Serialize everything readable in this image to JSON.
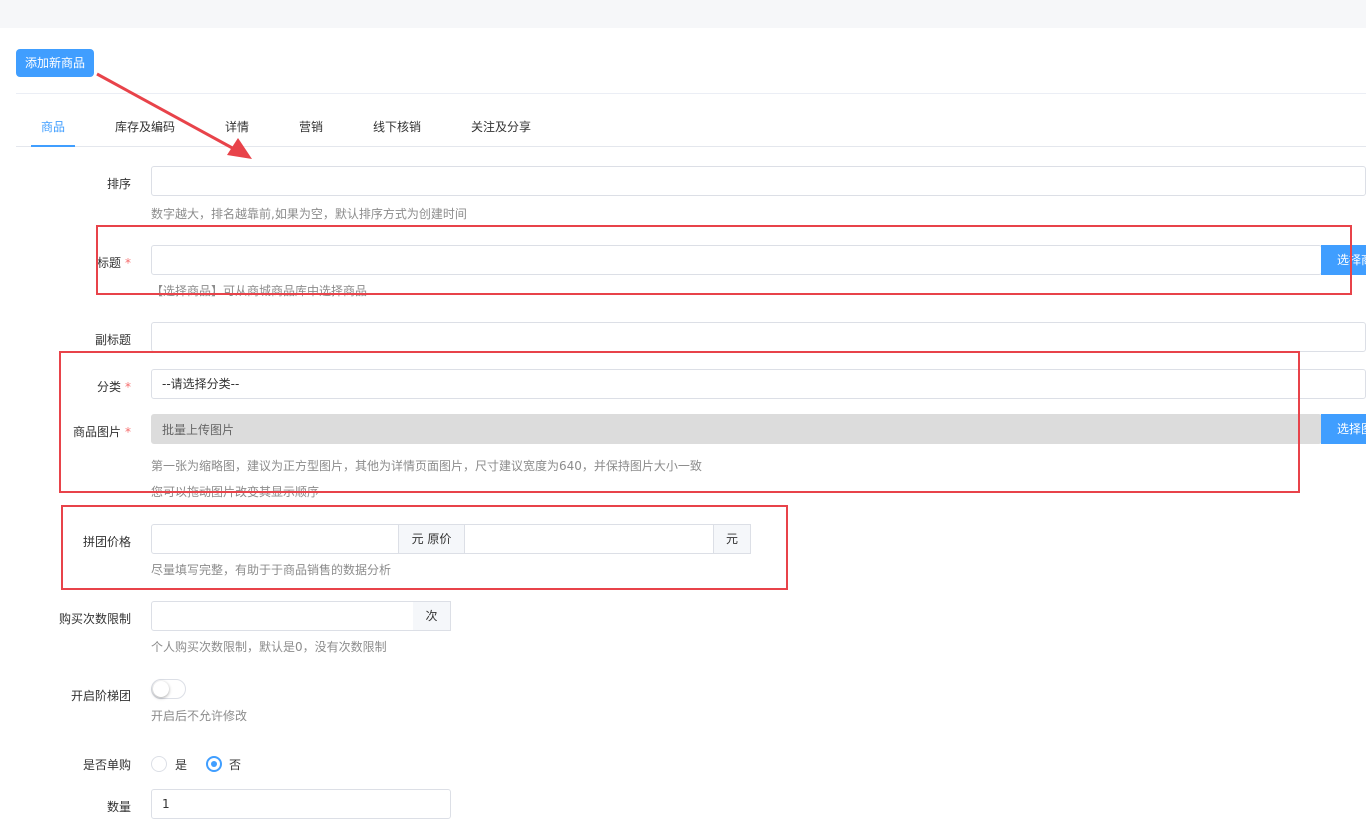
{
  "header": {
    "add_button_label": "添加新商品"
  },
  "tabs": [
    {
      "label": "商品",
      "active": true
    },
    {
      "label": "库存及编码",
      "active": false
    },
    {
      "label": "详情",
      "active": false
    },
    {
      "label": "营销",
      "active": false
    },
    {
      "label": "线下核销",
      "active": false
    },
    {
      "label": "关注及分享",
      "active": false
    }
  ],
  "form": {
    "sort": {
      "label": "排序",
      "value": "",
      "help": "数字越大，排名越靠前,如果为空，默认排序方式为创建时间"
    },
    "title": {
      "label": "标题",
      "required": "*",
      "value": "",
      "button_label": "选择商品",
      "help": "【选择商品】可从商城商品库中选择商品"
    },
    "subtitle": {
      "label": "副标题",
      "value": ""
    },
    "category": {
      "label": "分类",
      "required": "*",
      "selected": "--请选择分类--"
    },
    "images": {
      "label": "商品图片",
      "required": "*",
      "placeholder": "批量上传图片",
      "button_label": "选择图片",
      "help1": "第一张为缩略图，建议为正方型图片，其他为详情页面图片，尺寸建议宽度为640，并保持图片大小一致",
      "help2": "您可以拖动图片改变其显示顺序"
    },
    "price": {
      "label": "拼团价格",
      "group_price": "",
      "unit_original": "元 原价",
      "original_price": "",
      "unit": "元",
      "help": "尽量填写完整，有助于于商品销售的数据分析"
    },
    "limit": {
      "label": "购买次数限制",
      "value": "",
      "unit": "次",
      "help": "个人购买次数限制，默认是0，没有次数限制"
    },
    "ladder": {
      "label": "开启阶梯团",
      "enabled": false,
      "help": "开启后不允许修改"
    },
    "single": {
      "label": "是否单购",
      "yes_label": "是",
      "no_label": "否",
      "selected": "否"
    },
    "quantity": {
      "label": "数量",
      "value": "1"
    }
  },
  "colors": {
    "accent": "#409eff",
    "annotation": "#e8434a",
    "required": "#f56c6c"
  }
}
